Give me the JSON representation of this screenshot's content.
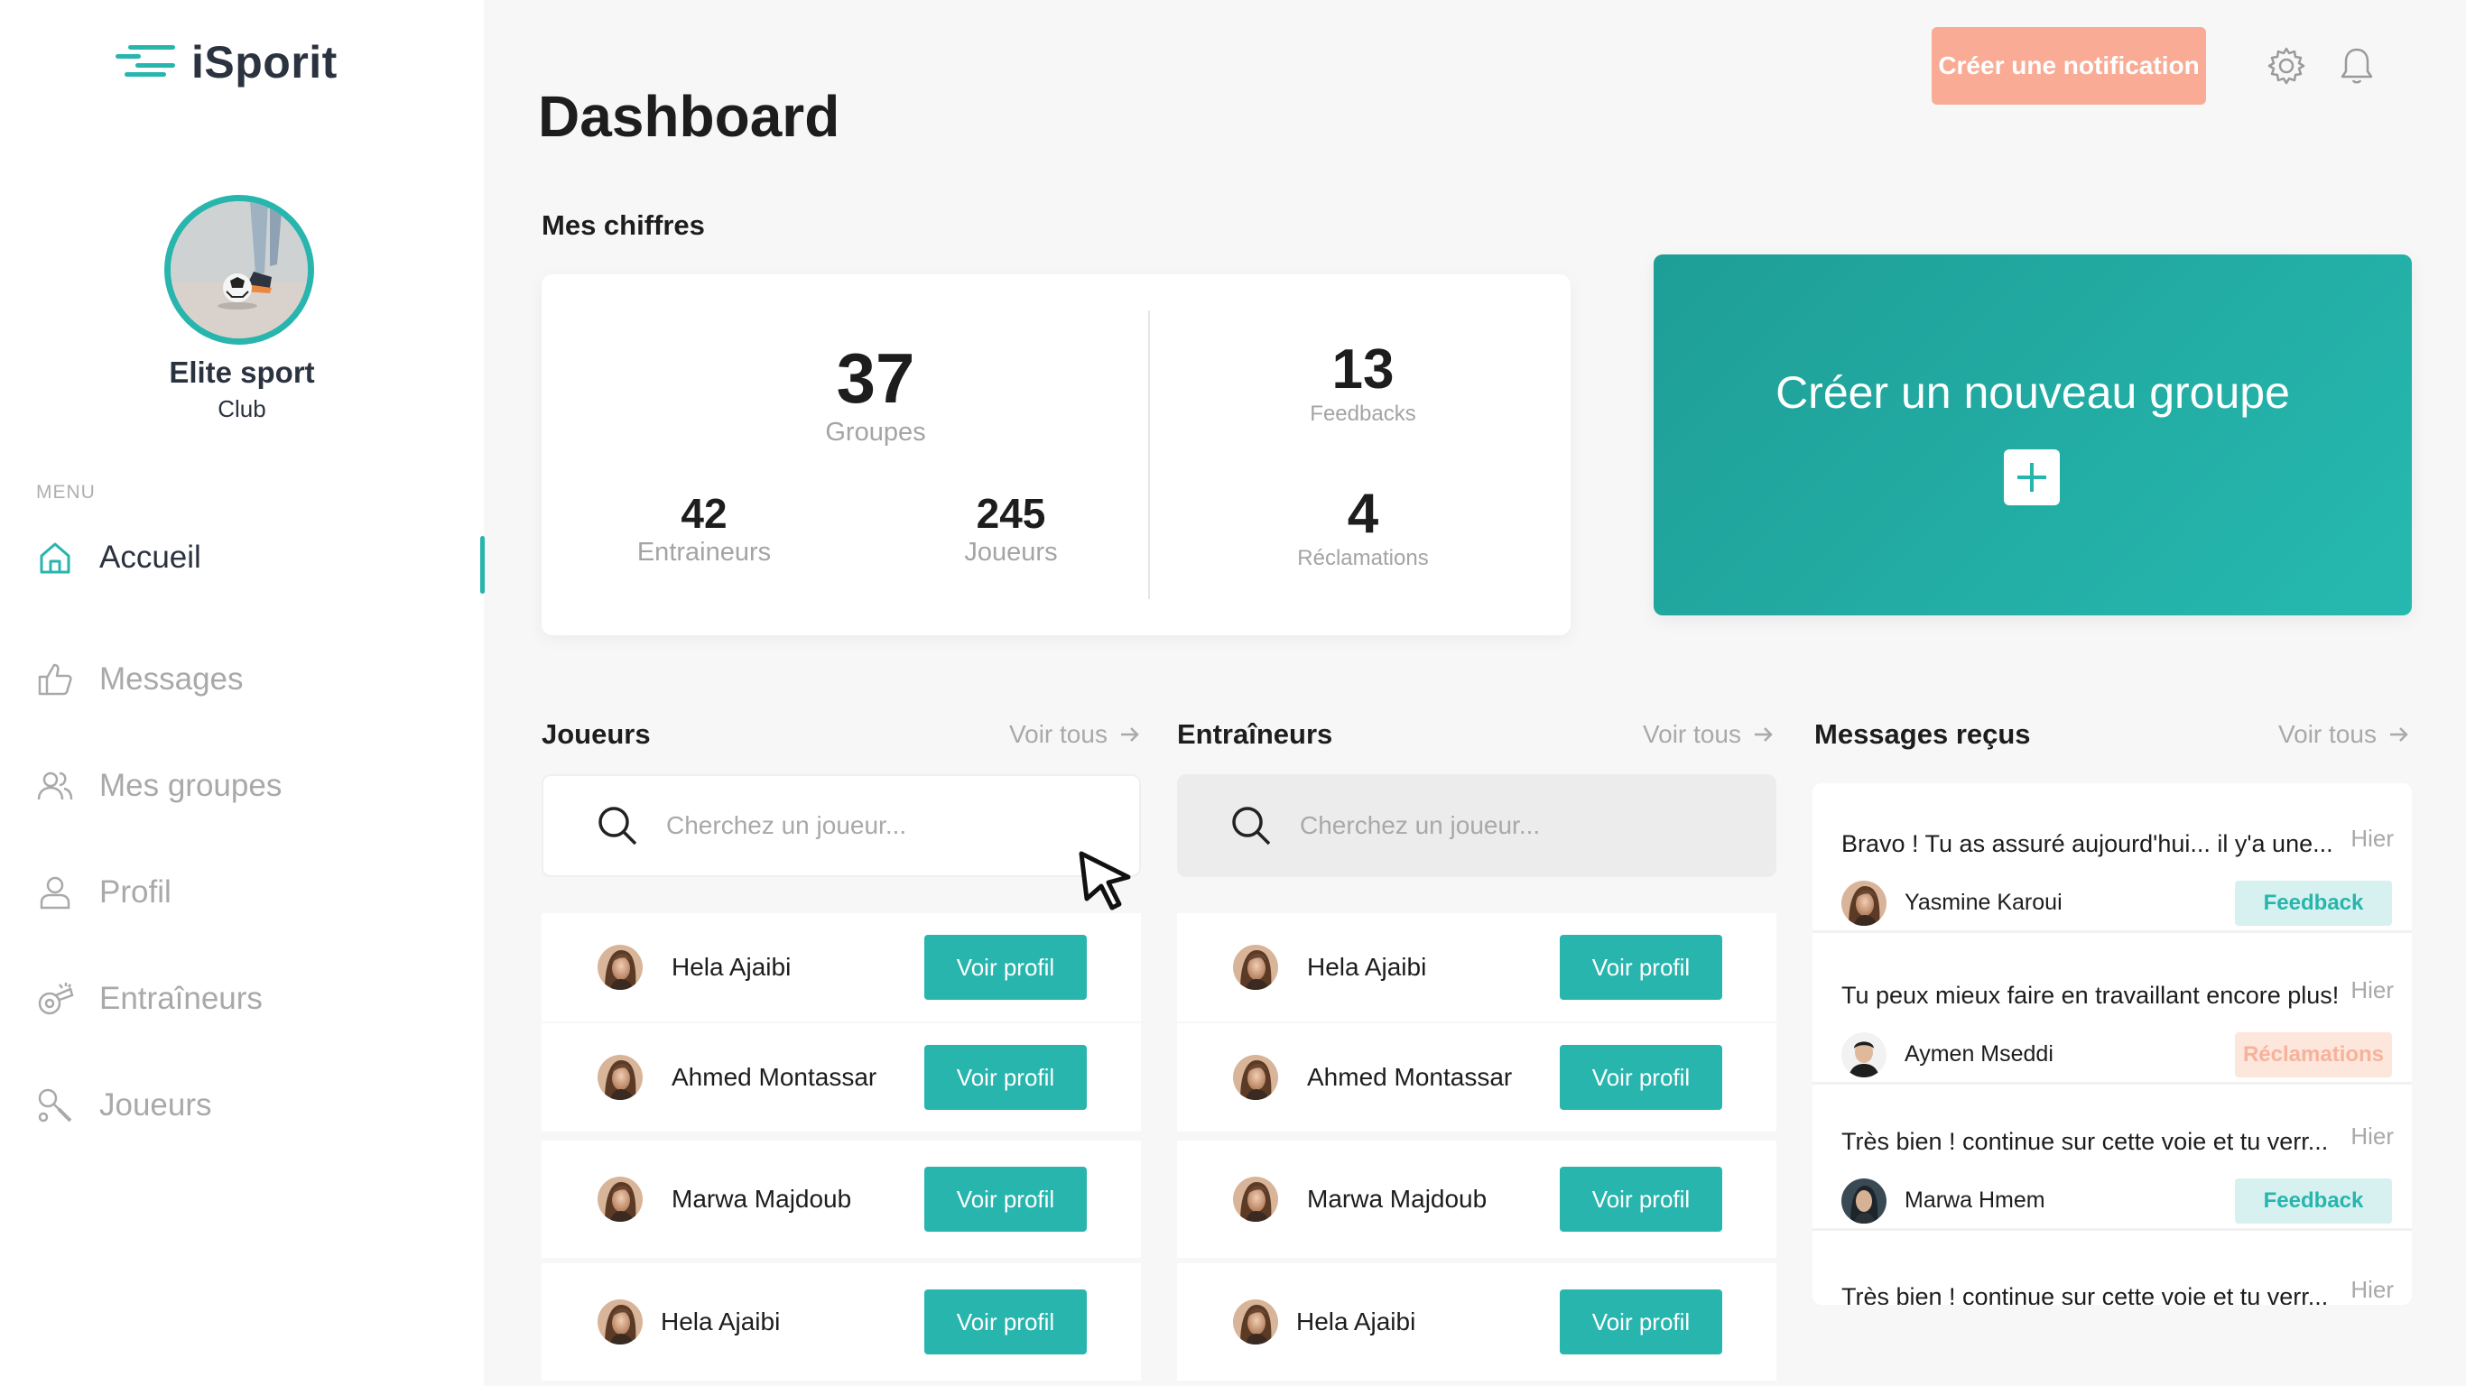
{
  "app": {
    "name": "iSporit",
    "brand_color": "#27b5ad",
    "accent_color": "#f9ab95"
  },
  "club": {
    "name": "Elite sport",
    "type": "Club"
  },
  "menu": {
    "title": "MENU",
    "items": [
      {
        "label": "Accueil",
        "icon": "home-icon",
        "active": true
      },
      {
        "label": "Messages",
        "icon": "thumbs-up-icon",
        "active": false
      },
      {
        "label": "Mes groupes",
        "icon": "users-icon",
        "active": false
      },
      {
        "label": "Profil",
        "icon": "user-icon",
        "active": false
      },
      {
        "label": "Entraîneurs",
        "icon": "whistle-icon",
        "active": false
      },
      {
        "label": "Joueurs",
        "icon": "racket-icon",
        "active": false
      }
    ]
  },
  "header": {
    "title": "Dashboard",
    "notification_button": "Créer une notification",
    "icons": [
      "gear-icon",
      "bell-icon"
    ]
  },
  "stats": {
    "section_title": "Mes chiffres",
    "groupes": {
      "value": "37",
      "label": "Groupes"
    },
    "entraineurs": {
      "value": "42",
      "label": "Entraineurs"
    },
    "joueurs": {
      "value": "245",
      "label": "Joueurs"
    },
    "feedbacks": {
      "value": "13",
      "label": "Feedbacks"
    },
    "reclamations": {
      "value": "4",
      "label": "Réclamations"
    }
  },
  "create_group": {
    "label": "Créer un nouveau groupe"
  },
  "players": {
    "title": "Joueurs",
    "see_all": "Voir tous",
    "search_placeholder": "Cherchez un joueur...",
    "rows": [
      {
        "name": "Hela Ajaibi",
        "button": "Voir profil"
      },
      {
        "name": "Ahmed Montassar",
        "button": "Voir profil"
      },
      {
        "name": "Marwa Majdoub",
        "button": "Voir profil"
      },
      {
        "name": "Hela Ajaibi",
        "button": "Voir profil"
      }
    ]
  },
  "coaches": {
    "title": "Entraîneurs",
    "see_all": "Voir tous",
    "search_placeholder": "Cherchez un joueur...",
    "rows": [
      {
        "name": "Hela Ajaibi",
        "button": "Voir profil"
      },
      {
        "name": "Ahmed Montassar",
        "button": "Voir profil"
      },
      {
        "name": "Marwa Majdoub",
        "button": "Voir profil"
      },
      {
        "name": "Hela Ajaibi",
        "button": "Voir profil"
      }
    ]
  },
  "messages": {
    "title": "Messages reçus",
    "see_all": "Voir tous",
    "items": [
      {
        "text": "Bravo ! Tu as assuré aujourd'hui... il y'a une...",
        "time": "Hier",
        "author": "Yasmine Karoui",
        "tag": "Feedback"
      },
      {
        "text": "Tu peux mieux faire en travaillant encore plus!",
        "time": "Hier",
        "author": "Aymen Mseddi",
        "tag": "Réclamations"
      },
      {
        "text": "Très bien ! continue sur cette voie et tu verr...",
        "time": "Hier",
        "author": "Marwa Hmem",
        "tag": "Feedback"
      },
      {
        "text": "Très bien ! continue sur cette voie et tu verr...",
        "time": "Hier",
        "author": "",
        "tag": ""
      }
    ]
  }
}
